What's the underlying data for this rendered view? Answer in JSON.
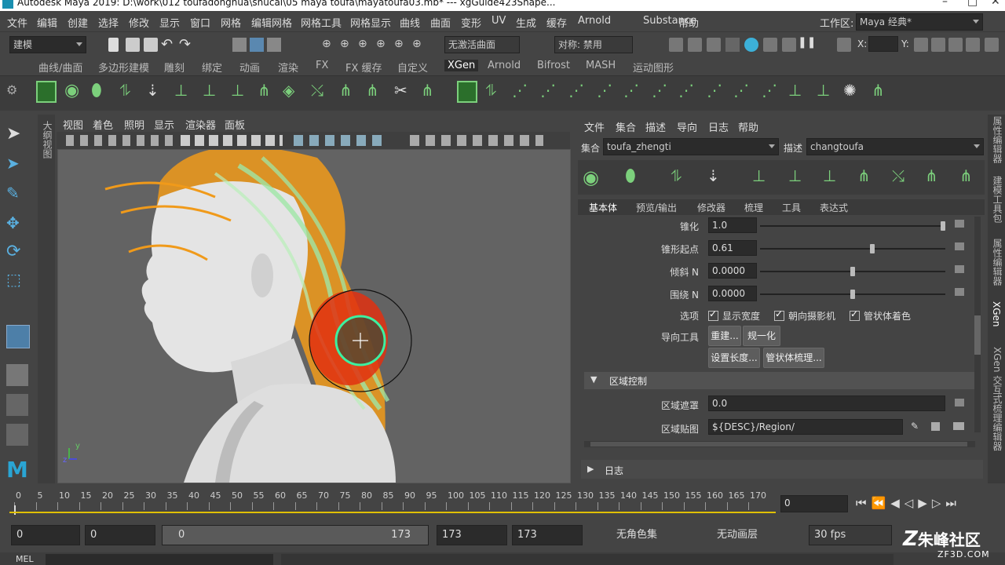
{
  "window": {
    "title": "Autodesk Maya 2019: D:\\work\\012 toufadonghua\\shucai\\05 maya toufa\\mayatoufa03.mb*   ---   xgGuide423Shape..."
  },
  "menubar": {
    "items": [
      "文件",
      "编辑",
      "创建",
      "选择",
      "修改",
      "显示",
      "窗口",
      "网格",
      "编辑网格",
      "网格工具",
      "网格显示",
      "曲线",
      "曲面",
      "变形",
      "UV",
      "生成",
      "缓存",
      "Arnold",
      "Substance",
      "帮助"
    ],
    "workspace_label": "工作区:",
    "workspace_value": "Maya 经典*"
  },
  "statusline": {
    "mode": "建模",
    "live_surface": "无激活曲面",
    "symmetry": "对称: 禁用",
    "x_label": "X:",
    "y_label": "Y:"
  },
  "shelf": {
    "tabs": [
      "曲线/曲面",
      "多边形建模",
      "雕刻",
      "绑定",
      "动画",
      "渲染",
      "FX",
      "FX 缓存",
      "自定义",
      "XGen",
      "Arnold",
      "Bifrost",
      "MASH",
      "运动图形"
    ],
    "active_tab": "XGen"
  },
  "viewport": {
    "menu": [
      "视图",
      "着色",
      "照明",
      "显示",
      "渲染器",
      "面板"
    ],
    "side_tab": "大纲视图",
    "axis_y": "y",
    "axis_z": "z"
  },
  "xgen": {
    "menu": [
      "文件",
      "集合",
      "描述",
      "导向",
      "日志",
      "帮助"
    ],
    "collection_label": "集合",
    "collection_value": "toufa_zhengti",
    "description_label": "描述",
    "description_value": "changtoufa",
    "tabs": [
      "基本体",
      "预览/输出",
      "修改器",
      "梳理",
      "工具",
      "表达式"
    ],
    "active_tab": "基本体",
    "params": [
      {
        "label": "锥化",
        "value": "1.0",
        "knob": 1.0
      },
      {
        "label": "锥形起点",
        "value": "0.61",
        "knob": 0.61
      },
      {
        "label": "倾斜 N",
        "value": "0.0000",
        "knob": 0.5
      },
      {
        "label": "围绕 N",
        "value": "0.0000",
        "knob": 0.5
      }
    ],
    "options_label": "选项",
    "options": [
      "显示宽度",
      "朝向摄影机",
      "管状体着色"
    ],
    "guide_tools_label": "导向工具",
    "guide_buttons": [
      "重建...",
      "规一化",
      "设置长度...",
      "管状体梳理..."
    ],
    "region_section": "区域控制",
    "region_mask_label": "区域遮罩",
    "region_mask_value": "0.0",
    "region_map_label": "区域贴图",
    "region_map_value": "${DESC}/Region/",
    "log_label": "日志"
  },
  "right_tabs": [
    "属性编辑器",
    "建模工具包",
    "属性编辑器",
    "XGen",
    "XGen 交互式梳理编辑器"
  ],
  "timeline": {
    "ticks": [
      "0",
      "5",
      "10",
      "15",
      "20",
      "25",
      "30",
      "35",
      "40",
      "45",
      "50",
      "55",
      "60",
      "65",
      "70",
      "75",
      "80",
      "85",
      "90",
      "95",
      "100",
      "105",
      "110",
      "115",
      "120",
      "125",
      "130",
      "135",
      "140",
      "145",
      "150",
      "155",
      "160",
      "165",
      "170"
    ],
    "current_frame": "0"
  },
  "range": {
    "start": "0",
    "anim_start": "0",
    "slider_start": "0",
    "slider_end": "173",
    "anim_end": "173",
    "end": "173",
    "char_set": "无角色集",
    "anim_layer": "无动画层",
    "fps": "30 fps"
  },
  "cmdline": {
    "label": "MEL"
  },
  "watermark": {
    "text": "朱峰社区",
    "site": "ZF3D.COM"
  },
  "colors": {
    "accent": "#4fb0e0",
    "hair_orange": "#f09a1a",
    "hair_green": "#9fe6a6",
    "brush_red": "#e03010"
  }
}
